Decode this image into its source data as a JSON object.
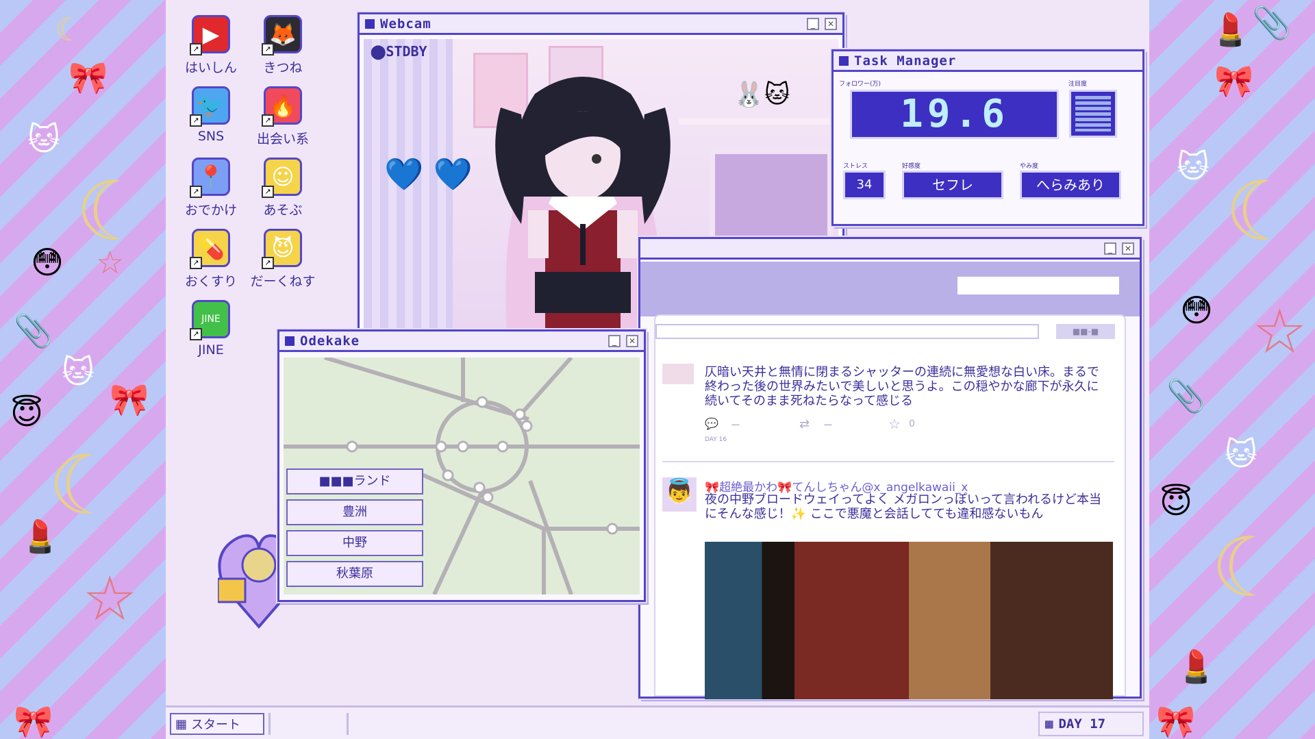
{
  "desktop_icons": [
    {
      "label": "はいしん",
      "icon": "video-play-icon",
      "color": "#e0282d",
      "glyph": "▶"
    },
    {
      "label": "きつね",
      "icon": "fox-bottle-icon",
      "color": "#2d2a33",
      "glyph": "🦊"
    },
    {
      "label": "SNS",
      "icon": "bird-icon",
      "color": "#4fa6f0",
      "glyph": "🐦"
    },
    {
      "label": "出会い系",
      "icon": "flame-icon",
      "color": "#f04a5c",
      "glyph": "🔥"
    },
    {
      "label": "おでかけ",
      "icon": "map-pin-icon",
      "color": "#7d9ef5",
      "glyph": "📍"
    },
    {
      "label": "あそぶ",
      "icon": "smiley-folder-icon",
      "color": "#f5d44a",
      "glyph": "☺"
    },
    {
      "label": "おくすり",
      "icon": "pill-folder-icon",
      "color": "#f5d44a",
      "glyph": "💊"
    },
    {
      "label": "だーくねす",
      "icon": "devil-folder-icon",
      "color": "#f5d44a",
      "glyph": "😈"
    },
    {
      "label": "JINE",
      "icon": "jine-chat-icon",
      "color": "#43c04a",
      "glyph": "JINE"
    }
  ],
  "webcam": {
    "title": "Webcam",
    "status": "STDBY"
  },
  "task_manager": {
    "title": "Task Manager",
    "followers_label": "フォロワー(万)",
    "followers_value": "19.6",
    "attention_label": "注目度",
    "stress_label": "ストレス",
    "stress_value": "34",
    "affection_label": "好感度",
    "affection_value": "セフレ",
    "yami_label": "やみ度",
    "yami_value": "へらみあり"
  },
  "sns": {
    "search_button": "■■-■",
    "posts": [
      {
        "text": "仄暗い天井と無情に閉まるシャッターの連続に無愛想な白い床。まるで終わった後の世界みたいで美しいと思うよ。この穏やかな廊下が永久に続いてそのまま死ねたらなって感じる",
        "reply_count": "ー",
        "rt_count": "ー",
        "fav_count": "0",
        "day": "DAY 16"
      },
      {
        "user": "🎀超絶最かわ🎀てんしちゃん@x_angelkawaii_x",
        "text": "夜の中野ブロードウェイってよく メガロンっぽいって言われるけど本当にそんな感じ！✨ ここで悪魔と会話してても違和感ないもん"
      }
    ]
  },
  "odekake": {
    "title": "Odekake",
    "places": [
      "■■■ランド",
      "豊洲",
      "中野",
      "秋葉原"
    ]
  },
  "taskbar": {
    "start_label": "スタート",
    "day_label": "DAY 17"
  }
}
